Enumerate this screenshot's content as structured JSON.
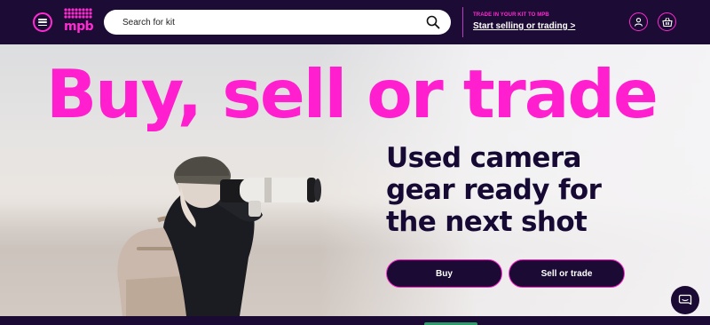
{
  "header": {
    "menu_icon": "hamburger-menu-icon",
    "logo_text": "mpb",
    "search": {
      "placeholder": "Search for kit",
      "icon": "search-icon"
    },
    "trade": {
      "eyebrow": "TRADE IN YOUR KIT TO MPB",
      "link": "Start selling or trading >"
    },
    "account_icon": "user-account-icon",
    "basket_icon": "basket-icon"
  },
  "hero": {
    "headline": "Buy, sell or trade",
    "subhead": "Used camera gear ready for the next shot",
    "buy_button": "Buy",
    "sell_button": "Sell or trade"
  },
  "chat": {
    "icon": "chat-icon"
  },
  "colors": {
    "brand_pink": "#ff1fcf",
    "navy": "#1b0a33",
    "accent_green": "#2b9c6a"
  }
}
